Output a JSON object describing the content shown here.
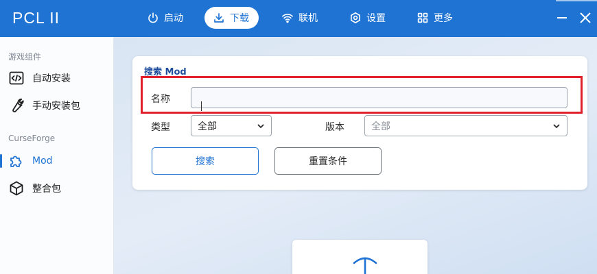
{
  "app": {
    "title": "PCL II"
  },
  "nav": [
    {
      "label": "启动",
      "icon": "power-icon"
    },
    {
      "label": "下载",
      "icon": "download-icon",
      "active": true
    },
    {
      "label": "联机",
      "icon": "wifi-icon"
    },
    {
      "label": "设置",
      "icon": "gear-icon"
    },
    {
      "label": "更多",
      "icon": "grid-icon"
    }
  ],
  "sidebar": {
    "groups": [
      {
        "label": "游戏组件",
        "items": [
          {
            "label": "自动安装",
            "icon": "code-window-icon"
          },
          {
            "label": "手动安装包",
            "icon": "wrench-icon"
          }
        ]
      },
      {
        "label": "CurseForge",
        "items": [
          {
            "label": "Mod",
            "icon": "puzzle-icon",
            "active": true
          },
          {
            "label": "整合包",
            "icon": "cube-icon"
          }
        ]
      }
    ]
  },
  "search": {
    "title": "搜索 Mod",
    "name_label": "名称",
    "name_value": "",
    "type_label": "类型",
    "type_value": "全部",
    "version_label": "版本",
    "version_value": "全部",
    "search_button": "搜索",
    "reset_button": "重置条件"
  },
  "colors": {
    "accent": "#1e73d3",
    "highlight": "#e0202a"
  }
}
